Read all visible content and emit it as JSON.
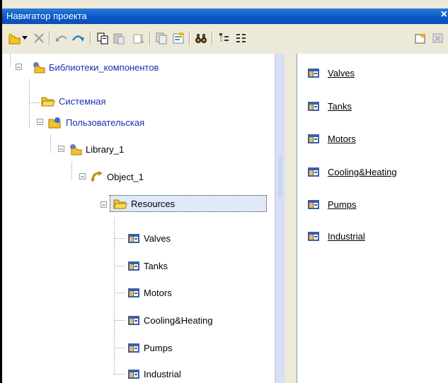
{
  "window": {
    "title": "Навигатор проекта",
    "close_label": "×"
  },
  "toolbar": {
    "icons": [
      "new-item-icon",
      "dropdown-arrow-icon",
      "delete-icon",
      "undo-icon",
      "redo-icon",
      "copy-icon",
      "paste-icon",
      "sort-icon",
      "duplicate-icon",
      "properties-icon",
      "find-icon",
      "tree-view-icon",
      "list-view-icon",
      "new-window-icon",
      "close-window-icon"
    ]
  },
  "tree": {
    "root": {
      "label": "Библиотеки_компонентов"
    },
    "system": {
      "label": "Системная"
    },
    "user": {
      "label": "Пользовательская"
    },
    "library": {
      "label": "Library_1"
    },
    "object": {
      "label": "Object_1"
    },
    "resources": {
      "label": "Resources"
    },
    "children": [
      {
        "label": "Valves"
      },
      {
        "label": "Tanks"
      },
      {
        "label": "Motors"
      },
      {
        "label": "Cooling&Heating"
      },
      {
        "label": "Pumps"
      },
      {
        "label": "Industrial"
      }
    ]
  },
  "right_list": [
    {
      "label": "Valves"
    },
    {
      "label": "Tanks"
    },
    {
      "label": "Motors"
    },
    {
      "label": "Cooling&Heating"
    },
    {
      "label": "Pumps"
    },
    {
      "label": "Industrial"
    }
  ],
  "colors": {
    "titlebar": "#0a56c8",
    "selection": "#dfe9f7",
    "link_blue": "#1a2fb0"
  }
}
